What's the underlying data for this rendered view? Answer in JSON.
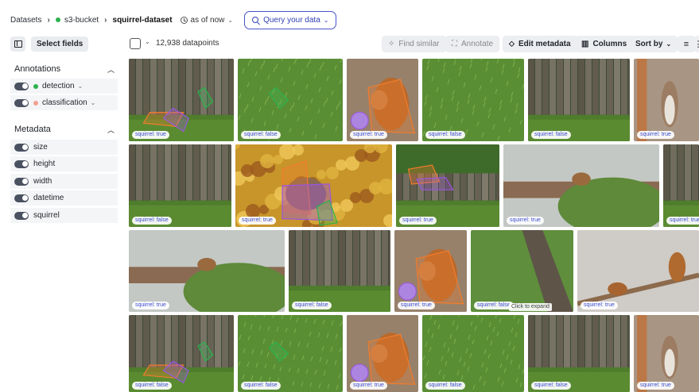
{
  "breadcrumb": {
    "root": "Datasets",
    "bucket": "s3-bucket",
    "dataset": "squirrel-dataset",
    "as_of": "as of now",
    "query_button": "Query your data"
  },
  "sidebar": {
    "select_fields": "Select fields",
    "annotations_title": "Annotations",
    "annotations": [
      {
        "label": "detection",
        "color": "#2bb24c"
      },
      {
        "label": "classification",
        "color": "#f2a093"
      }
    ],
    "metadata_title": "Metadata",
    "metadata": [
      "size",
      "height",
      "width",
      "datetime",
      "squirrel"
    ]
  },
  "toolbar": {
    "count": "12,938 datapoints",
    "find_similar": "Find similar",
    "annotate": "Annotate",
    "edit_metadata": "Edit metadata",
    "columns": "Columns",
    "sort_by": "Sort by"
  },
  "grid": {
    "hint": "Click to expand",
    "tiles": [
      {
        "kind": "fence",
        "label": "squirrel: true",
        "ann": true
      },
      {
        "kind": "grass",
        "label": "squirrel: false",
        "ann": true
      },
      {
        "kind": "squirrel",
        "label": "squirrel: true",
        "ann": true
      },
      {
        "kind": "grass",
        "label": "squirrel: false",
        "ann": false
      },
      {
        "kind": "fence",
        "label": "squirrel: false",
        "ann": false
      },
      {
        "kind": "tree",
        "label": "squirrel: true",
        "ann": false
      },
      {
        "kind": "fence",
        "label": "squirrel: false",
        "ann": false
      },
      {
        "kind": "autumn",
        "label": "squirrel: true",
        "ann": true
      },
      {
        "kind": "fence2",
        "label": "squirrel: true",
        "ann": true
      },
      {
        "kind": "outdoor",
        "label": "squirrel: true",
        "ann": false
      },
      {
        "kind": "fence",
        "label": "squirrel: true",
        "ann": false
      },
      {
        "kind": "outdoor",
        "label": "squirrel: true",
        "ann": false
      },
      {
        "kind": "fence",
        "label": "squirrel: false",
        "ann": false
      },
      {
        "kind": "squirrel",
        "label": "squirrel: true",
        "ann": true
      },
      {
        "kind": "trunk",
        "label": "squirrel: false",
        "ann": false
      },
      {
        "kind": "branch",
        "label": "squirrel: true",
        "ann": false
      },
      {
        "kind": "fence",
        "label": "squirrel: false",
        "ann": true
      },
      {
        "kind": "grass",
        "label": "squirrel: false",
        "ann": true
      },
      {
        "kind": "squirrel",
        "label": "squirrel: true",
        "ann": true
      },
      {
        "kind": "grass",
        "label": "squirrel: false",
        "ann": false
      },
      {
        "kind": "fence",
        "label": "squirrel: false",
        "ann": false
      },
      {
        "kind": "tree",
        "label": "squirrel: true",
        "ann": false
      }
    ]
  }
}
